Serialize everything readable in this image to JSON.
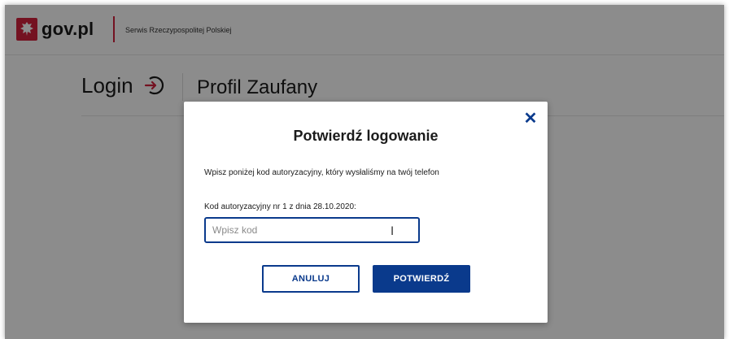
{
  "header": {
    "brand": "gov.pl",
    "subtitle": "Serwis Rzeczypospolitej Polskiej"
  },
  "page": {
    "login_label": "Login",
    "service_label": "Profil Zaufany"
  },
  "modal": {
    "title": "Potwierdź logowanie",
    "description": "Wpisz poniżej kod autoryzacyjny, który wysłaliśmy na twój telefon",
    "code_label": "Kod autoryzacyjny nr 1 z dnia 28.10.2020:",
    "code_placeholder": "Wpisz kod",
    "code_value": "",
    "close_symbol": "✕",
    "cancel_label": "ANULUJ",
    "confirm_label": "POTWIERDŹ"
  },
  "colors": {
    "brand_red": "#d4213d",
    "primary_blue": "#0a3a8c"
  },
  "icons": {
    "emblem": "polish-eagle-emblem",
    "login": "login-arrow-icon",
    "close": "close-icon",
    "cursor": "text-cursor-icon"
  }
}
